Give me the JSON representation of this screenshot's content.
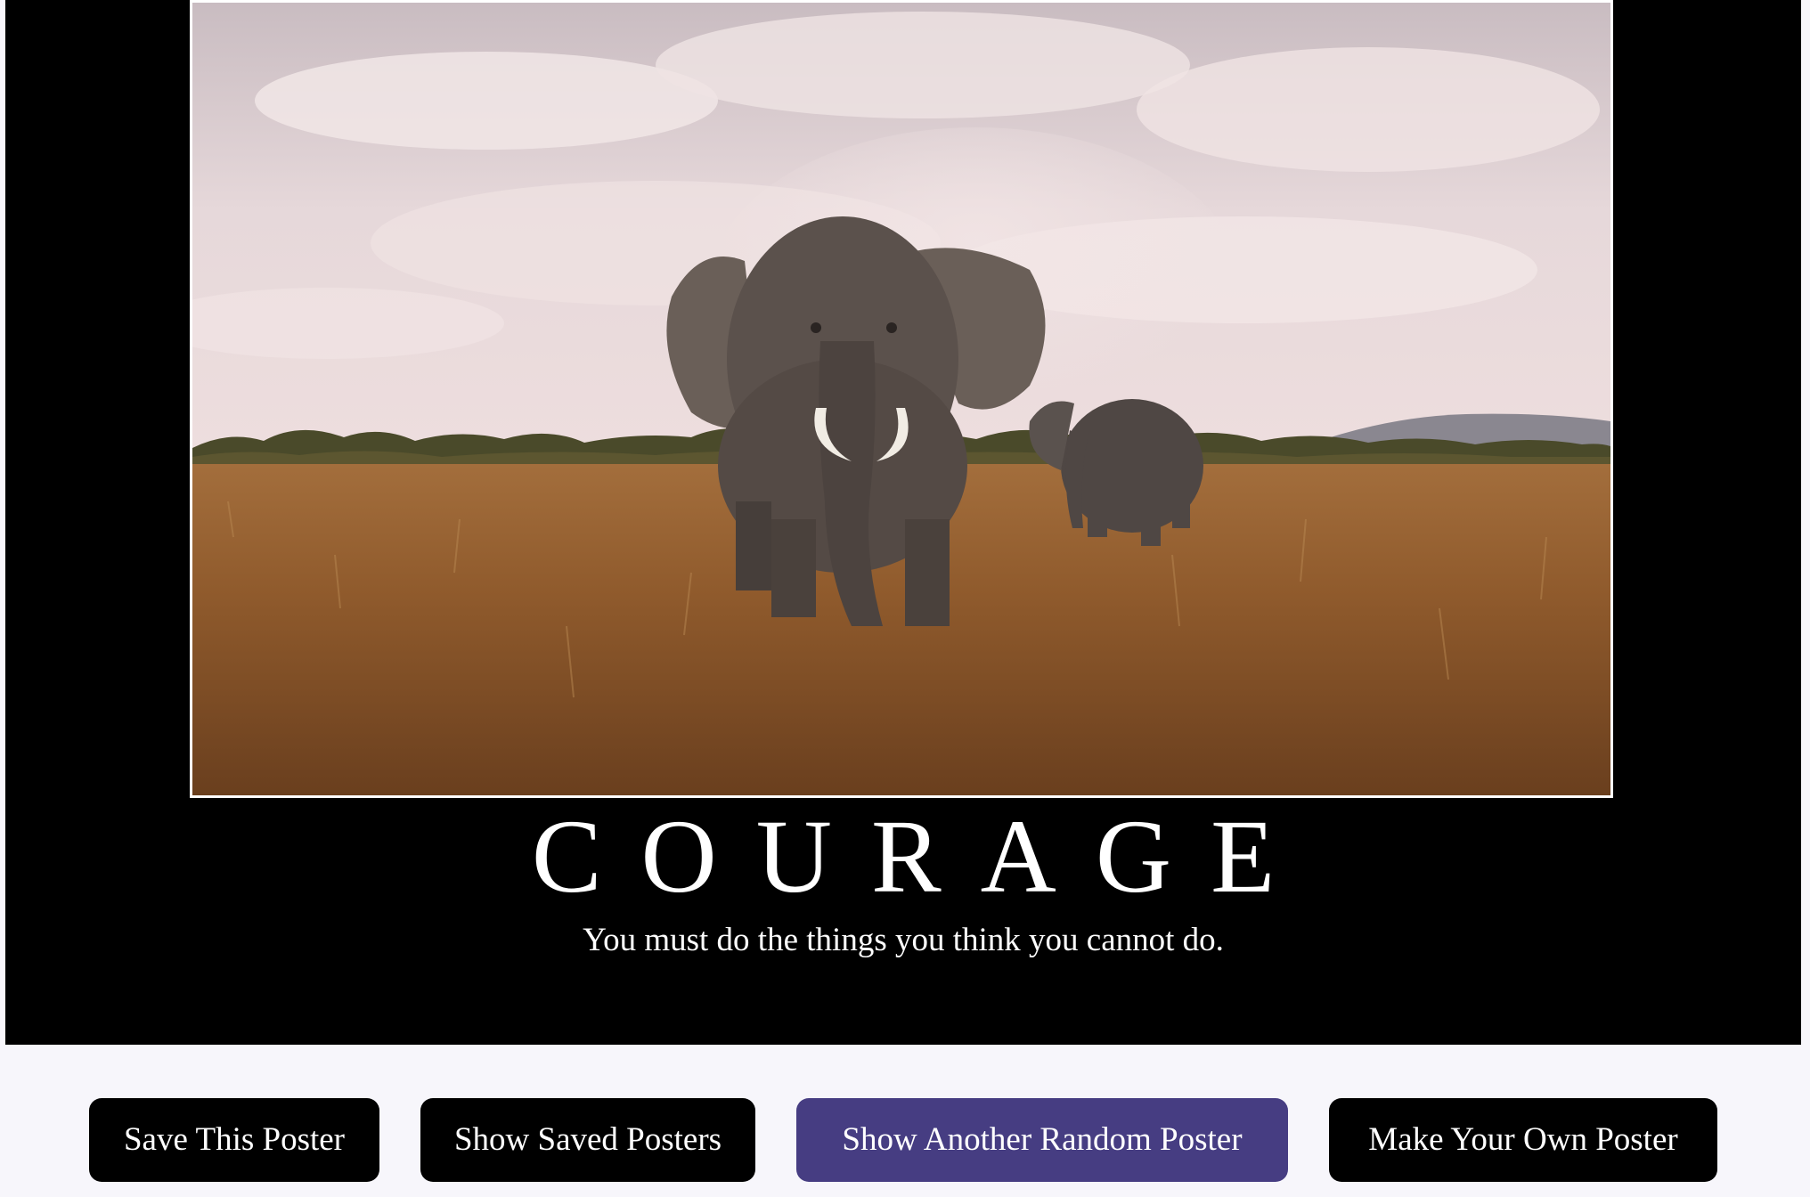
{
  "poster": {
    "image_alt": "Two elephants walking through golden savanna grass under a cloudy sky",
    "title": "COURAGE",
    "quote": "You must do the things you think you cannot do."
  },
  "controls": {
    "save_label": "Save This Poster",
    "show_saved_label": "Show Saved Posters",
    "random_label": "Show Another Random Poster",
    "make_own_label": "Make Your Own Poster"
  },
  "colors": {
    "poster_background": "#000000",
    "page_background": "#f7f6fb",
    "button_background": "#000000",
    "button_active_background": "#463d82",
    "text": "#ffffff"
  }
}
